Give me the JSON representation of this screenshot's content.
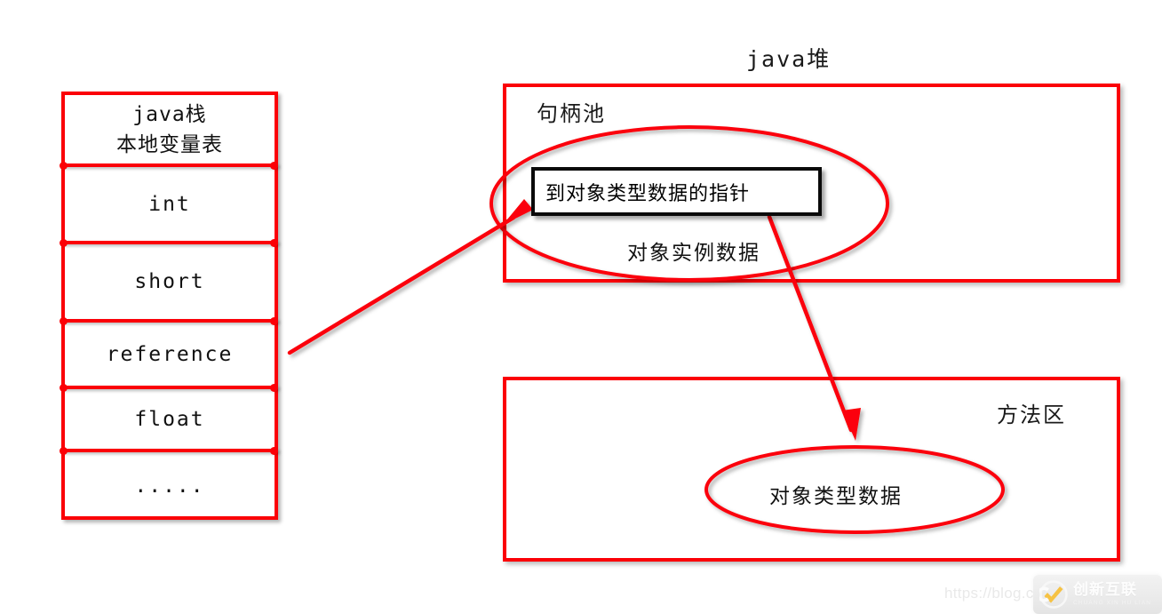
{
  "diagram": {
    "title_heap": "java堆",
    "stack": {
      "header_line1": "java栈",
      "header_line2": "本地变量表",
      "rows": [
        {
          "label": "int"
        },
        {
          "label": "short"
        },
        {
          "label": "reference"
        },
        {
          "label": "float"
        },
        {
          "label": "....."
        }
      ]
    },
    "heap": {
      "label": "句柄池",
      "pointer_box_text": "到对象类型数据的指针",
      "instance_data_text": "对象实例数据"
    },
    "method_area": {
      "label": "方法区",
      "ellipse_text": "对象类型数据"
    }
  },
  "watermark": {
    "url": "https://blog.csd",
    "brand": "创新互联",
    "brand_pinyin": "CHUANG XIN HU LIAN"
  },
  "colors": {
    "accent_red": "#fb0007",
    "box_black": "#0a0a0a",
    "text": "#1a1a1a"
  }
}
